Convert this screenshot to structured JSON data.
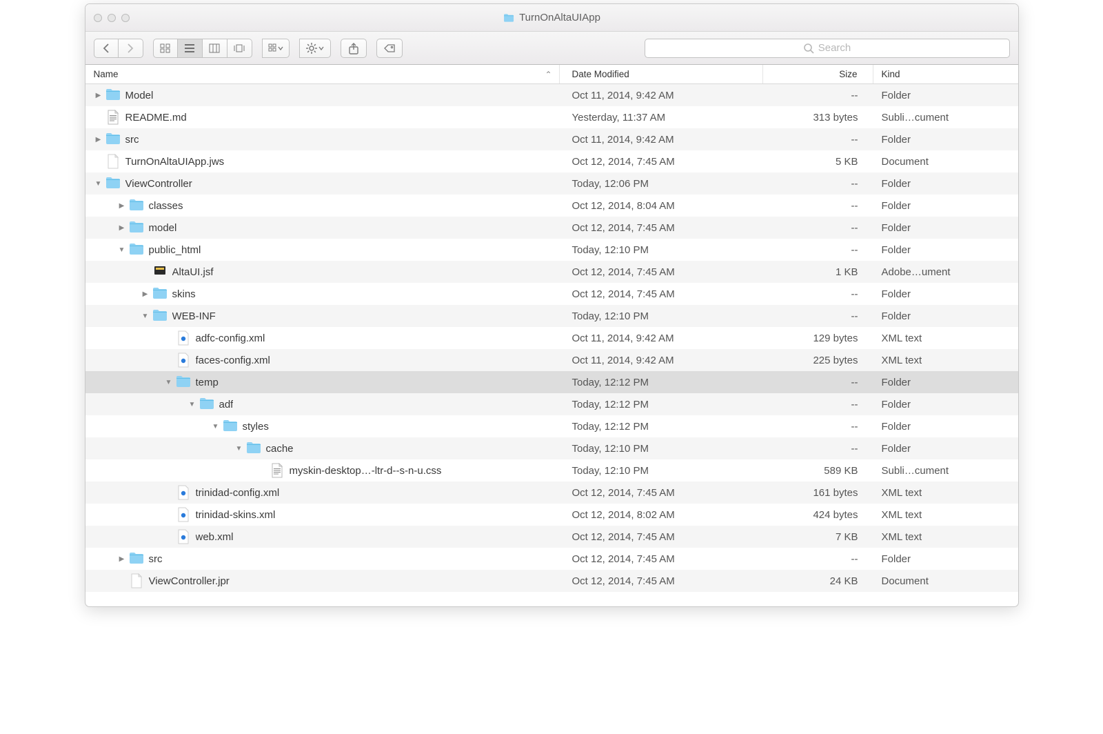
{
  "window": {
    "title": "TurnOnAltaUIApp"
  },
  "search": {
    "placeholder": "Search"
  },
  "columns": {
    "name": "Name",
    "date": "Date Modified",
    "size": "Size",
    "kind": "Kind"
  },
  "rows": [
    {
      "indent": 0,
      "disclosure": "right",
      "icon": "folder",
      "name": "Model",
      "date": "Oct 11, 2014, 9:42 AM",
      "size": "--",
      "kind": "Folder"
    },
    {
      "indent": 0,
      "disclosure": "",
      "icon": "doc-lines",
      "name": "README.md",
      "date": "Yesterday, 11:37 AM",
      "size": "313 bytes",
      "kind": "Subli…cument"
    },
    {
      "indent": 0,
      "disclosure": "right",
      "icon": "folder",
      "name": "src",
      "date": "Oct 11, 2014, 9:42 AM",
      "size": "--",
      "kind": "Folder"
    },
    {
      "indent": 0,
      "disclosure": "",
      "icon": "doc",
      "name": "TurnOnAltaUIApp.jws",
      "date": "Oct 12, 2014, 7:45 AM",
      "size": "5 KB",
      "kind": "Document"
    },
    {
      "indent": 0,
      "disclosure": "down",
      "icon": "folder",
      "name": "ViewController",
      "date": "Today, 12:06 PM",
      "size": "--",
      "kind": "Folder"
    },
    {
      "indent": 1,
      "disclosure": "right",
      "icon": "folder",
      "name": "classes",
      "date": "Oct 12, 2014, 8:04 AM",
      "size": "--",
      "kind": "Folder"
    },
    {
      "indent": 1,
      "disclosure": "right",
      "icon": "folder",
      "name": "model",
      "date": "Oct 12, 2014, 7:45 AM",
      "size": "--",
      "kind": "Folder"
    },
    {
      "indent": 1,
      "disclosure": "down",
      "icon": "folder",
      "name": "public_html",
      "date": "Today, 12:10 PM",
      "size": "--",
      "kind": "Folder"
    },
    {
      "indent": 2,
      "disclosure": "",
      "icon": "jsf",
      "name": "AltaUI.jsf",
      "date": "Oct 12, 2014, 7:45 AM",
      "size": "1 KB",
      "kind": "Adobe…ument"
    },
    {
      "indent": 2,
      "disclosure": "right",
      "icon": "folder",
      "name": "skins",
      "date": "Oct 12, 2014, 7:45 AM",
      "size": "--",
      "kind": "Folder"
    },
    {
      "indent": 2,
      "disclosure": "down",
      "icon": "folder",
      "name": "WEB-INF",
      "date": "Today, 12:10 PM",
      "size": "--",
      "kind": "Folder"
    },
    {
      "indent": 3,
      "disclosure": "",
      "icon": "xml",
      "name": "adfc-config.xml",
      "date": "Oct 11, 2014, 9:42 AM",
      "size": "129 bytes",
      "kind": "XML text"
    },
    {
      "indent": 3,
      "disclosure": "",
      "icon": "xml",
      "name": "faces-config.xml",
      "date": "Oct 11, 2014, 9:42 AM",
      "size": "225 bytes",
      "kind": "XML text"
    },
    {
      "indent": 3,
      "disclosure": "down",
      "icon": "folder",
      "name": "temp",
      "date": "Today, 12:12 PM",
      "size": "--",
      "kind": "Folder",
      "selected": true
    },
    {
      "indent": 4,
      "disclosure": "down",
      "icon": "folder",
      "name": "adf",
      "date": "Today, 12:12 PM",
      "size": "--",
      "kind": "Folder"
    },
    {
      "indent": 5,
      "disclosure": "down",
      "icon": "folder",
      "name": "styles",
      "date": "Today, 12:12 PM",
      "size": "--",
      "kind": "Folder"
    },
    {
      "indent": 6,
      "disclosure": "down",
      "icon": "folder",
      "name": "cache",
      "date": "Today, 12:10 PM",
      "size": "--",
      "kind": "Folder"
    },
    {
      "indent": 7,
      "disclosure": "",
      "icon": "doc-lines",
      "name": "myskin-desktop…-ltr-d--s-n-u.css",
      "date": "Today, 12:10 PM",
      "size": "589 KB",
      "kind": "Subli…cument"
    },
    {
      "indent": 3,
      "disclosure": "",
      "icon": "xml",
      "name": "trinidad-config.xml",
      "date": "Oct 12, 2014, 7:45 AM",
      "size": "161 bytes",
      "kind": "XML text"
    },
    {
      "indent": 3,
      "disclosure": "",
      "icon": "xml",
      "name": "trinidad-skins.xml",
      "date": "Oct 12, 2014, 8:02 AM",
      "size": "424 bytes",
      "kind": "XML text"
    },
    {
      "indent": 3,
      "disclosure": "",
      "icon": "xml",
      "name": "web.xml",
      "date": "Oct 12, 2014, 7:45 AM",
      "size": "7 KB",
      "kind": "XML text"
    },
    {
      "indent": 1,
      "disclosure": "right",
      "icon": "folder",
      "name": "src",
      "date": "Oct 12, 2014, 7:45 AM",
      "size": "--",
      "kind": "Folder"
    },
    {
      "indent": 1,
      "disclosure": "",
      "icon": "doc",
      "name": "ViewController.jpr",
      "date": "Oct 12, 2014, 7:45 AM",
      "size": "24 KB",
      "kind": "Document"
    }
  ]
}
